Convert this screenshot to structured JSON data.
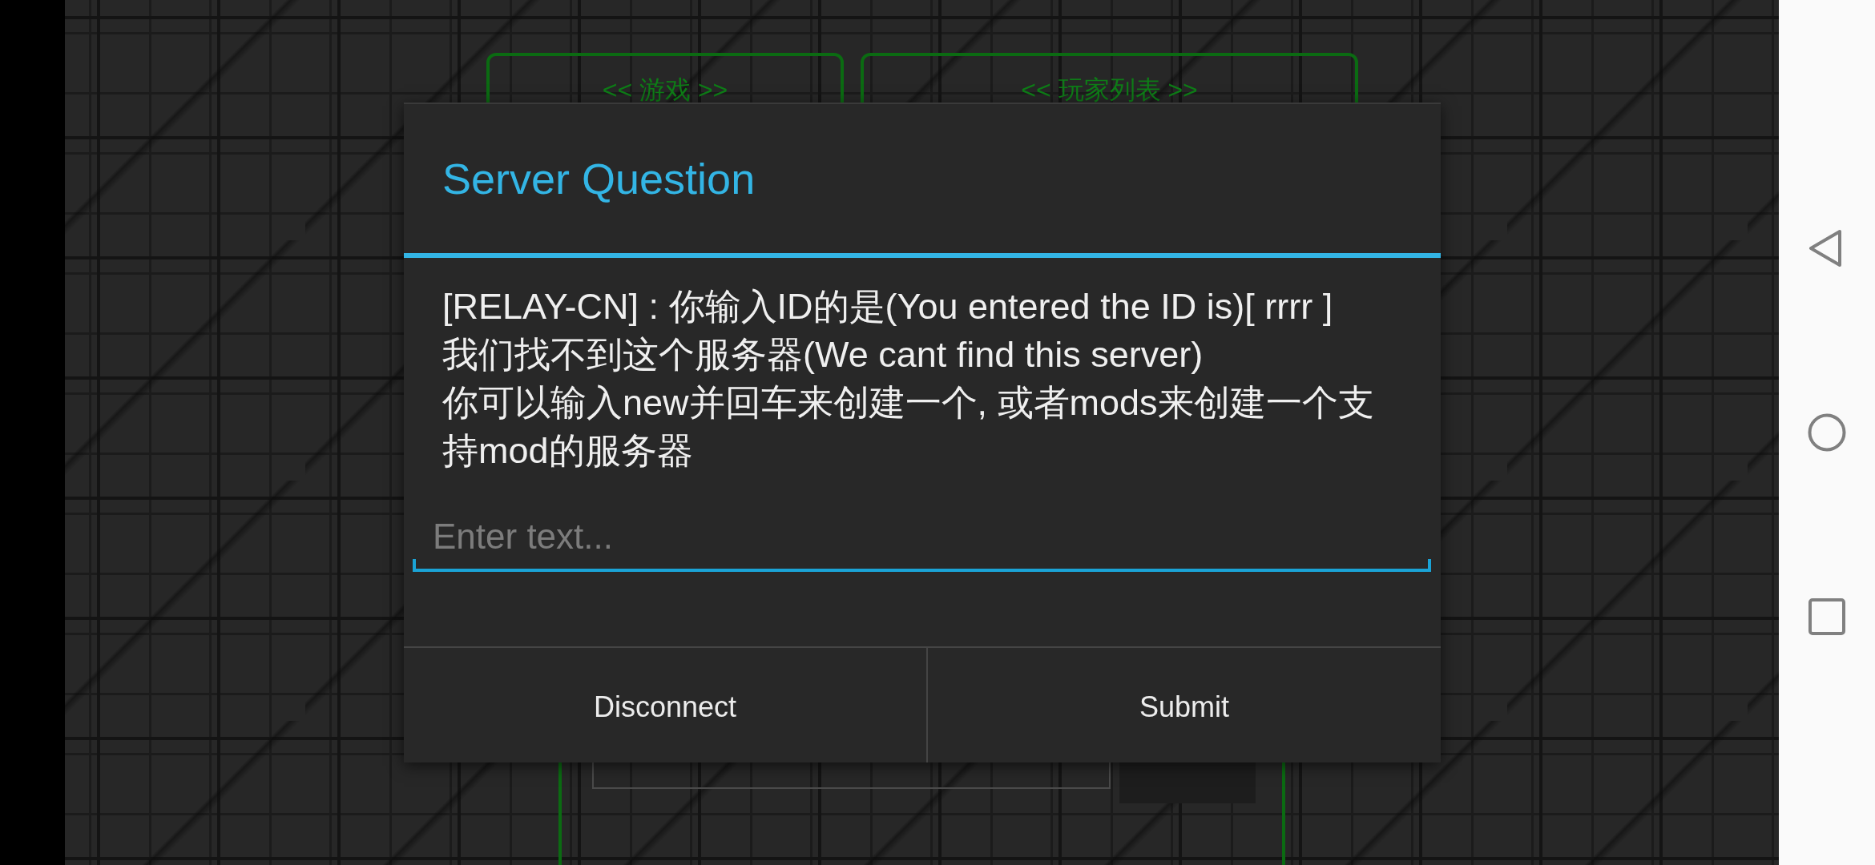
{
  "game_screen": {
    "panels": [
      {
        "heading": "<< 游戏 >>"
      },
      {
        "heading": "<< 玩家列表 >>"
      }
    ]
  },
  "dialog": {
    "title": "Server Question",
    "message": "[RELAY-CN] : 你输入ID的是(You entered the ID is)[ rrrr ]\n我们找不到这个服务器(We cant find this server)\n你可以输入new并回车来创建一个, 或者mods来创建一个支持mod的服务器",
    "input": {
      "placeholder": "Enter text..."
    },
    "buttons": [
      "Disconnect",
      "Submit"
    ]
  }
}
